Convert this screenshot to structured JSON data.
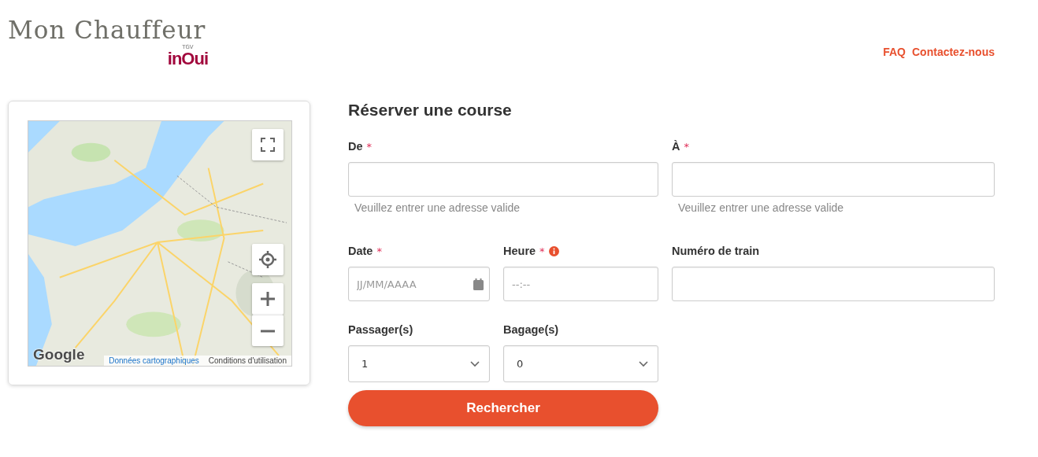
{
  "header": {
    "brand": "Mon Chauffeur",
    "sub_brand_small": "TGV",
    "sub_brand": "inOui",
    "nav": [
      "FAQ",
      "Contactez-nous"
    ]
  },
  "map": {
    "logo": "Google",
    "links": [
      "Données cartographiques",
      "Conditions d'utilisation"
    ]
  },
  "form": {
    "title": "Réserver une course",
    "fields": [
      {
        "kind": "address",
        "label": "De",
        "required_mark": "*",
        "hint": "Veuillez entrer une adresse valide"
      },
      {
        "kind": "address",
        "label": "À",
        "required_mark": "*",
        "hint": "Veuillez entrer une adresse valide"
      },
      {
        "kind": "date",
        "label": "Date",
        "required_mark": "*",
        "placeholder": "JJ/MM/AAAA"
      },
      {
        "kind": "time",
        "label": "Heure",
        "required_mark": "*",
        "info": true,
        "placeholder": "--:--"
      },
      {
        "kind": "text",
        "label": "Numéro de train"
      },
      {
        "kind": "select",
        "label": "Passager(s)",
        "value": "1"
      },
      {
        "kind": "select",
        "label": "Bagage(s)",
        "value": "0"
      }
    ],
    "submit": "Rechercher"
  }
}
